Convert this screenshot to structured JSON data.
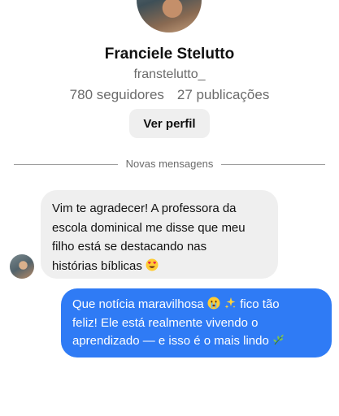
{
  "profile": {
    "name": "Franciele Stelutto",
    "handle": "franstelutto_",
    "followers": "780 seguidores",
    "posts": "27 publicações",
    "view_profile_label": "Ver perfil"
  },
  "divider": {
    "label": "Novas mensagens"
  },
  "messages": [
    {
      "from": "them",
      "lines": [
        "Vim te agradecer! A professora da",
        "escola dominical me disse que meu",
        "filho está se destacando nas",
        "histórias bíblicas"
      ],
      "trailing_emoji": "heart-eyes-emoji"
    },
    {
      "from": "me",
      "lines": [
        "Que notícia maravilhosa",
        "fico tão",
        "feliz! Ele está realmente vivendo o",
        "aprendizado — e isso é o mais lindo"
      ],
      "emojis": [
        "crying-face-emoji",
        "sparkles-emoji",
        "herb-emoji"
      ]
    }
  ],
  "colors": {
    "outgoing_bubble": "#2f7bf5",
    "incoming_bubble": "#efefef",
    "muted_text": "#6b6b6b"
  }
}
